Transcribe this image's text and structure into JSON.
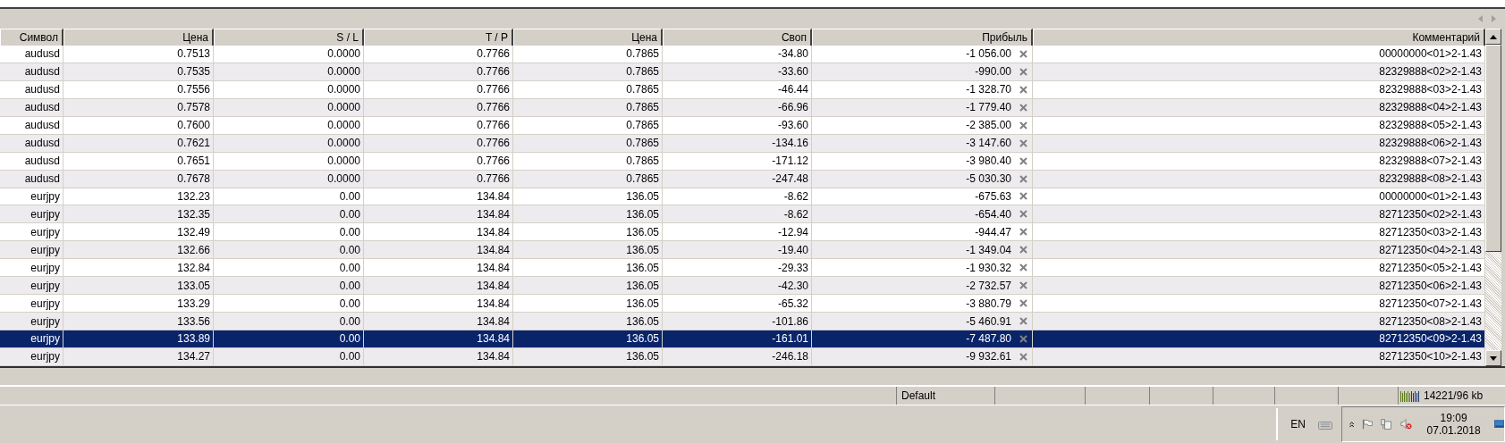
{
  "table": {
    "columns": [
      "Символ",
      "Цена",
      "S / L",
      "T / P",
      "Цена",
      "Своп",
      "Прибыль",
      "Комментарий"
    ],
    "rows": [
      {
        "cells": [
          "audusd",
          "0.7513",
          "0.0000",
          "0.7766",
          "0.7865",
          "-34.80",
          "-1 056.00",
          "00000000<01>2-1.43"
        ],
        "selected": false
      },
      {
        "cells": [
          "audusd",
          "0.7535",
          "0.0000",
          "0.7766",
          "0.7865",
          "-33.60",
          "-990.00",
          "82329888<02>2-1.43"
        ],
        "selected": false
      },
      {
        "cells": [
          "audusd",
          "0.7556",
          "0.0000",
          "0.7766",
          "0.7865",
          "-46.44",
          "-1 328.70",
          "82329888<03>2-1.43"
        ],
        "selected": false
      },
      {
        "cells": [
          "audusd",
          "0.7578",
          "0.0000",
          "0.7766",
          "0.7865",
          "-66.96",
          "-1 779.40",
          "82329888<04>2-1.43"
        ],
        "selected": false
      },
      {
        "cells": [
          "audusd",
          "0.7600",
          "0.0000",
          "0.7766",
          "0.7865",
          "-93.60",
          "-2 385.00",
          "82329888<05>2-1.43"
        ],
        "selected": false
      },
      {
        "cells": [
          "audusd",
          "0.7621",
          "0.0000",
          "0.7766",
          "0.7865",
          "-134.16",
          "-3 147.60",
          "82329888<06>2-1.43"
        ],
        "selected": false
      },
      {
        "cells": [
          "audusd",
          "0.7651",
          "0.0000",
          "0.7766",
          "0.7865",
          "-171.12",
          "-3 980.40",
          "82329888<07>2-1.43"
        ],
        "selected": false
      },
      {
        "cells": [
          "audusd",
          "0.7678",
          "0.0000",
          "0.7766",
          "0.7865",
          "-247.48",
          "-5 030.30",
          "82329888<08>2-1.43"
        ],
        "selected": false
      },
      {
        "cells": [
          "eurjpy",
          "132.23",
          "0.00",
          "134.84",
          "136.05",
          "-8.62",
          "-675.63",
          "00000000<01>2-1.43"
        ],
        "selected": false
      },
      {
        "cells": [
          "eurjpy",
          "132.35",
          "0.00",
          "134.84",
          "136.05",
          "-8.62",
          "-654.40",
          "82712350<02>2-1.43"
        ],
        "selected": false
      },
      {
        "cells": [
          "eurjpy",
          "132.49",
          "0.00",
          "134.84",
          "136.05",
          "-12.94",
          "-944.47",
          "82712350<03>2-1.43"
        ],
        "selected": false
      },
      {
        "cells": [
          "eurjpy",
          "132.66",
          "0.00",
          "134.84",
          "136.05",
          "-19.40",
          "-1 349.04",
          "82712350<04>2-1.43"
        ],
        "selected": false
      },
      {
        "cells": [
          "eurjpy",
          "132.84",
          "0.00",
          "134.84",
          "136.05",
          "-29.33",
          "-1 930.32",
          "82712350<05>2-1.43"
        ],
        "selected": false
      },
      {
        "cells": [
          "eurjpy",
          "133.05",
          "0.00",
          "134.84",
          "136.05",
          "-42.30",
          "-2 732.57",
          "82712350<06>2-1.43"
        ],
        "selected": false
      },
      {
        "cells": [
          "eurjpy",
          "133.29",
          "0.00",
          "134.84",
          "136.05",
          "-65.32",
          "-3 880.79",
          "82712350<07>2-1.43"
        ],
        "selected": false
      },
      {
        "cells": [
          "eurjpy",
          "133.56",
          "0.00",
          "134.84",
          "136.05",
          "-101.86",
          "-5 460.91",
          "82712350<08>2-1.43"
        ],
        "selected": false
      },
      {
        "cells": [
          "eurjpy",
          "133.89",
          "0.00",
          "134.84",
          "136.05",
          "-161.01",
          "-7 487.80",
          "82712350<09>2-1.43"
        ],
        "selected": true
      },
      {
        "cells": [
          "eurjpy",
          "134.27",
          "0.00",
          "134.84",
          "136.05",
          "-246.18",
          "-9 932.61",
          "82712350<10>2-1.43"
        ],
        "selected": false
      }
    ]
  },
  "status_bar": {
    "profile": "Default",
    "memory": "14221/96 kb"
  },
  "taskbar": {
    "language": "EN",
    "time": "19:09",
    "date": "07.01.2018"
  }
}
